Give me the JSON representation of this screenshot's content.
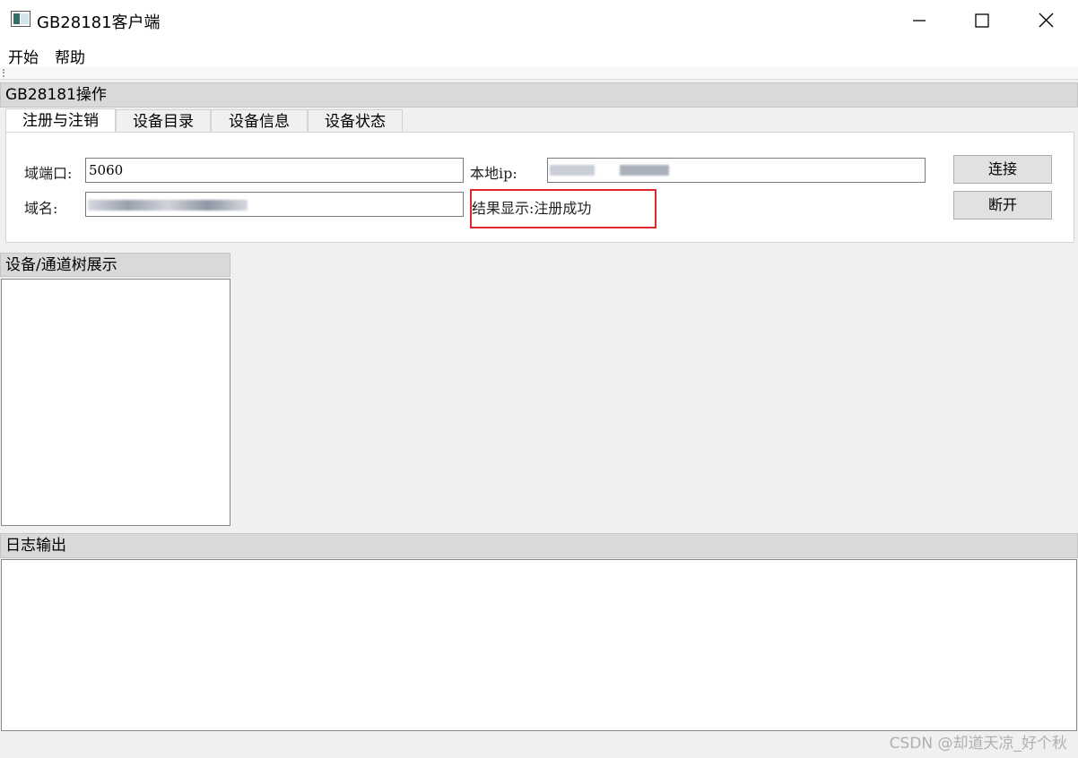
{
  "window": {
    "title": "GB28181客户端",
    "icons": [
      "app-icon",
      "minimize-icon",
      "maximize-icon",
      "close-icon"
    ]
  },
  "menu": {
    "items": [
      "开始",
      "帮助"
    ]
  },
  "operation_panel": {
    "title": "GB28181操作",
    "tabs": [
      {
        "label": "注册与注销",
        "active": true
      },
      {
        "label": "设备目录",
        "active": false
      },
      {
        "label": "设备信息",
        "active": false
      },
      {
        "label": "设备状态",
        "active": false
      }
    ],
    "domain_port_label": "域端口:",
    "domain_port_value": "5060",
    "local_ip_label": "本地ip:",
    "domain_name_label": "域名:",
    "result_label": "结果显示:",
    "result_value": "注册成功",
    "connect_button": "连接",
    "disconnect_button": "断开",
    "highlight_color": "#e0292f"
  },
  "tree_panel": {
    "title": "设备/通道树展示"
  },
  "log_panel": {
    "title": "日志输出"
  },
  "watermark": "CSDN @却道天凉_好个秋"
}
